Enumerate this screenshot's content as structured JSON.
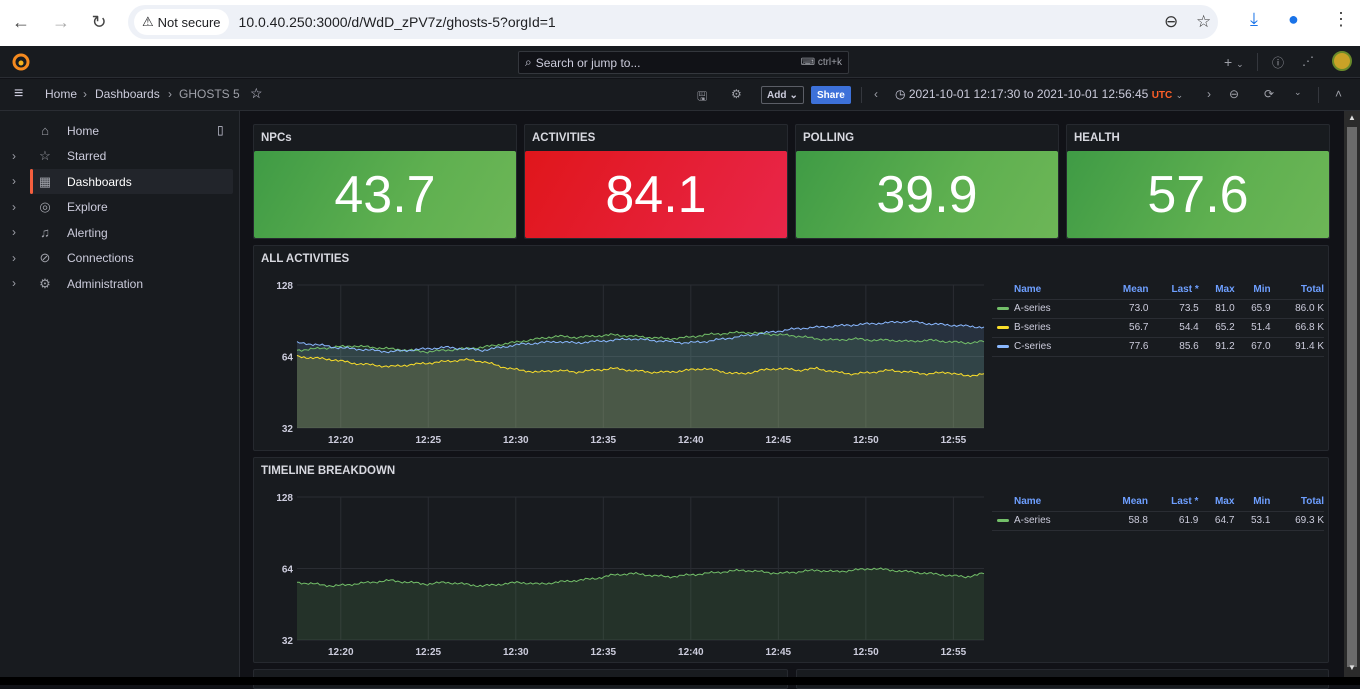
{
  "browser": {
    "security_label": "Not secure",
    "url": "10.0.40.250:3000/d/WdD_zPV7z/ghosts-5?orgId=1"
  },
  "topbar": {
    "search_placeholder": "Search or jump to...",
    "search_shortcut": "ctrl+k",
    "plus_label": "+"
  },
  "subbar": {
    "breadcrumb": [
      "Home",
      "Dashboards",
      "GHOSTS 5"
    ],
    "add_label": "Add",
    "share_label": "Share",
    "time_range": "2021-10-01 12:17:30 to 2021-10-01 12:56:45",
    "timezone": "UTC"
  },
  "sidebar": {
    "items": [
      {
        "label": "Home",
        "icon": "home-icon",
        "expandable": false
      },
      {
        "label": "Starred",
        "icon": "star-icon",
        "expandable": true
      },
      {
        "label": "Dashboards",
        "icon": "dashboards-icon",
        "expandable": true,
        "active": true
      },
      {
        "label": "Explore",
        "icon": "compass-icon",
        "expandable": true
      },
      {
        "label": "Alerting",
        "icon": "bell-icon",
        "expandable": true
      },
      {
        "label": "Connections",
        "icon": "connections-icon",
        "expandable": true
      },
      {
        "label": "Administration",
        "icon": "gear-icon",
        "expandable": true
      }
    ]
  },
  "stats": [
    {
      "title": "NPCs",
      "value": "43.7",
      "status": "green"
    },
    {
      "title": "ACTIVITIES",
      "value": "84.1",
      "status": "red"
    },
    {
      "title": "POLLING",
      "value": "39.9",
      "status": "green"
    },
    {
      "title": "HEALTH",
      "value": "57.6",
      "status": "green"
    }
  ],
  "colors": {
    "green": "#73bf69",
    "yellow": "#fade2a",
    "blue": "#8ab8ff",
    "red": "#e0161b",
    "accent": "#f55f3e",
    "legend_header": "#6e9fff"
  },
  "chart_data": [
    {
      "type": "area",
      "title": "ALL ACTIVITIES",
      "x_ticks": [
        "12:20",
        "12:25",
        "12:30",
        "12:35",
        "12:40",
        "12:45",
        "12:50",
        "12:55"
      ],
      "y_ticks": [
        "128",
        "64",
        "32"
      ],
      "y_scale": "log2",
      "ylim": [
        32,
        128
      ],
      "x_range": [
        "12:17:30",
        "12:56:45"
      ],
      "legend_placement": "right",
      "legend_columns": [
        "Name",
        "Mean",
        "Last *",
        "Max",
        "Min",
        "Total"
      ],
      "series": [
        {
          "name": "A-series",
          "color": "#73bf69",
          "mean": "73.0",
          "last": "73.5",
          "max": "81.0",
          "min": "65.9",
          "total": "86.0 K",
          "values": [
            68,
            69,
            70,
            71,
            70,
            69,
            68,
            67,
            68,
            69,
            70,
            72,
            74,
            76,
            78,
            77,
            78,
            79,
            78,
            77,
            76,
            77,
            79,
            80,
            81,
            80,
            79,
            78,
            76,
            75,
            76,
            75,
            75,
            74,
            75,
            74,
            73,
            74
          ]
        },
        {
          "name": "B-series",
          "color": "#fade2a",
          "mean": "56.7",
          "last": "54.4",
          "max": "65.2",
          "min": "51.4",
          "total": "66.8 K",
          "values": [
            64,
            63,
            62,
            60,
            59,
            58,
            59,
            60,
            61,
            62,
            61,
            58,
            56,
            55,
            56,
            55,
            56,
            57,
            56,
            55,
            55,
            56,
            57,
            55,
            54,
            56,
            57,
            56,
            57,
            55,
            54,
            55,
            56,
            55,
            54,
            55,
            53,
            54
          ]
        },
        {
          "name": "C-series",
          "color": "#8ab8ff",
          "mean": "77.6",
          "last": "85.6",
          "max": "91.2",
          "min": "67.0",
          "total": "91.4 K",
          "values": [
            73,
            72,
            70,
            69,
            68,
            67,
            68,
            69,
            70,
            69,
            68,
            70,
            72,
            73,
            74,
            73,
            74,
            75,
            76,
            75,
            74,
            73,
            74,
            76,
            78,
            80,
            82,
            84,
            85,
            86,
            87,
            88,
            89,
            90,
            88,
            87,
            86,
            85
          ]
        }
      ]
    },
    {
      "type": "area",
      "title": "TIMELINE BREAKDOWN",
      "x_ticks": [
        "12:20",
        "12:25",
        "12:30",
        "12:35",
        "12:40",
        "12:45",
        "12:50",
        "12:55"
      ],
      "y_ticks": [
        "128",
        "64",
        "32"
      ],
      "y_scale": "log2",
      "ylim": [
        32,
        128
      ],
      "x_range": [
        "12:17:30",
        "12:56:45"
      ],
      "legend_placement": "right",
      "legend_columns": [
        "Name",
        "Mean",
        "Last *",
        "Max",
        "Min",
        "Total"
      ],
      "series": [
        {
          "name": "A-series",
          "color": "#73bf69",
          "mean": "58.8",
          "last": "61.9",
          "max": "64.7",
          "min": "53.1",
          "total": "69.3 K",
          "values": [
            56,
            55,
            54,
            55,
            56,
            57,
            56,
            55,
            56,
            55,
            54,
            55,
            56,
            55,
            56,
            57,
            58,
            60,
            61,
            60,
            59,
            60,
            61,
            62,
            63,
            62,
            61,
            62,
            63,
            62,
            63,
            64,
            63,
            62,
            61,
            60,
            59,
            61
          ]
        }
      ]
    }
  ]
}
